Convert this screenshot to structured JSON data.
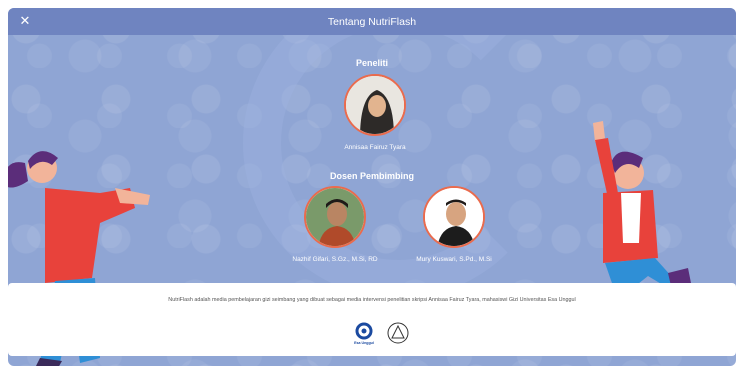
{
  "header": {
    "title": "Tentang NutriFlash",
    "close_icon": "close-icon"
  },
  "peneliti": {
    "title": "Peneliti",
    "name": "Annisaa Fairuz Tyara"
  },
  "dosen": {
    "title": "Dosen Pembimbing",
    "people": [
      {
        "name": "Nazhif Gifari, S.Gz., M.Si, RD"
      },
      {
        "name": "Mury Kuswari, S.Pd., M.Si"
      }
    ]
  },
  "footer": {
    "text": "NutriFlash adalah media pembelajaran gizi seimbang yang dibuat sebagai media intervensi penelitian skripsi Annisaa Fairuz Tyara, mahasiswi Gizi Universitas Esa Unggul",
    "logo_university_label": "Esa Unggul",
    "logos": [
      "esa-unggul-logo",
      "department-seal-logo"
    ]
  },
  "colors": {
    "header": "#6f84c0",
    "background": "#8fa5d4",
    "avatar_border": "#ea6b4d"
  }
}
